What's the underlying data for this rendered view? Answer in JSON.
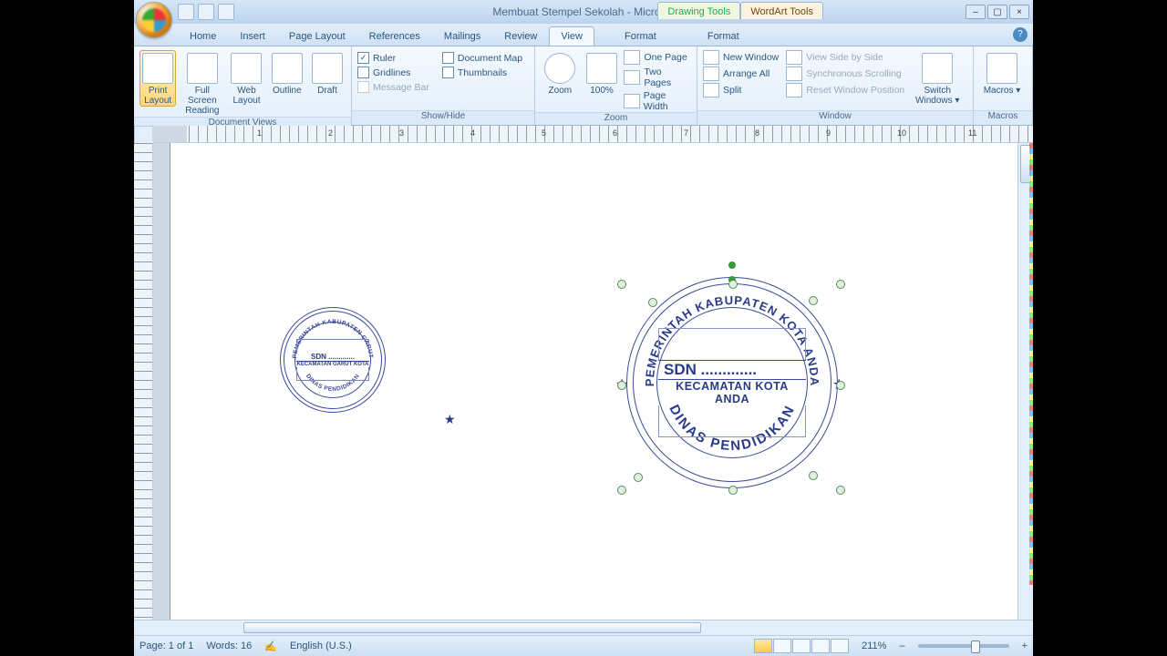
{
  "title": "Membuat Stempel Sekolah - Microsoft Word",
  "contextual": {
    "drawing": "Drawing Tools",
    "wordart": "WordArt Tools"
  },
  "tabs": {
    "home": "Home",
    "insert": "Insert",
    "pagelayout": "Page Layout",
    "references": "References",
    "mailings": "Mailings",
    "review": "Review",
    "view": "View",
    "format1": "Format",
    "format2": "Format"
  },
  "ribbon": {
    "views": {
      "print": "Print Layout",
      "full": "Full Screen Reading",
      "web": "Web Layout",
      "outline": "Outline",
      "draft": "Draft",
      "group": "Document Views"
    },
    "showhide": {
      "ruler": "Ruler",
      "gridlines": "Gridlines",
      "msgbar": "Message Bar",
      "docmap": "Document Map",
      "thumbs": "Thumbnails",
      "group": "Show/Hide"
    },
    "zoom": {
      "zoom": "Zoom",
      "pct": "100%",
      "one": "One Page",
      "two": "Two Pages",
      "pw": "Page Width",
      "group": "Zoom"
    },
    "window": {
      "new": "New Window",
      "arrange": "Arrange All",
      "split": "Split",
      "side": "View Side by Side",
      "sync": "Synchronous Scrolling",
      "reset": "Reset Window Position",
      "switch": "Switch Windows",
      "group": "Window"
    },
    "macros": {
      "macros": "Macros",
      "group": "Macros"
    }
  },
  "stamp_small": {
    "top": "PEMERINTAH KABUPATEN GARUT",
    "sdn": "SDN .............",
    "kec": "KECAMATAN GARUT KOTA",
    "bottom": "DINAS PENDIDIKAN"
  },
  "stamp_large": {
    "top": "PEMERINTAH KABUPATEN KOTA ANDA",
    "sdn": "SDN .............",
    "kec": "KECAMATAN KOTA ANDA",
    "bottom": "DINAS PENDIDIKAN"
  },
  "status": {
    "page": "Page: 1 of 1",
    "words": "Words: 16",
    "lang": "English (U.S.)",
    "zoom": "211%"
  },
  "ruler_nums": [
    "1",
    "2",
    "3",
    "4",
    "5",
    "6",
    "7",
    "8",
    "9",
    "10",
    "11"
  ]
}
